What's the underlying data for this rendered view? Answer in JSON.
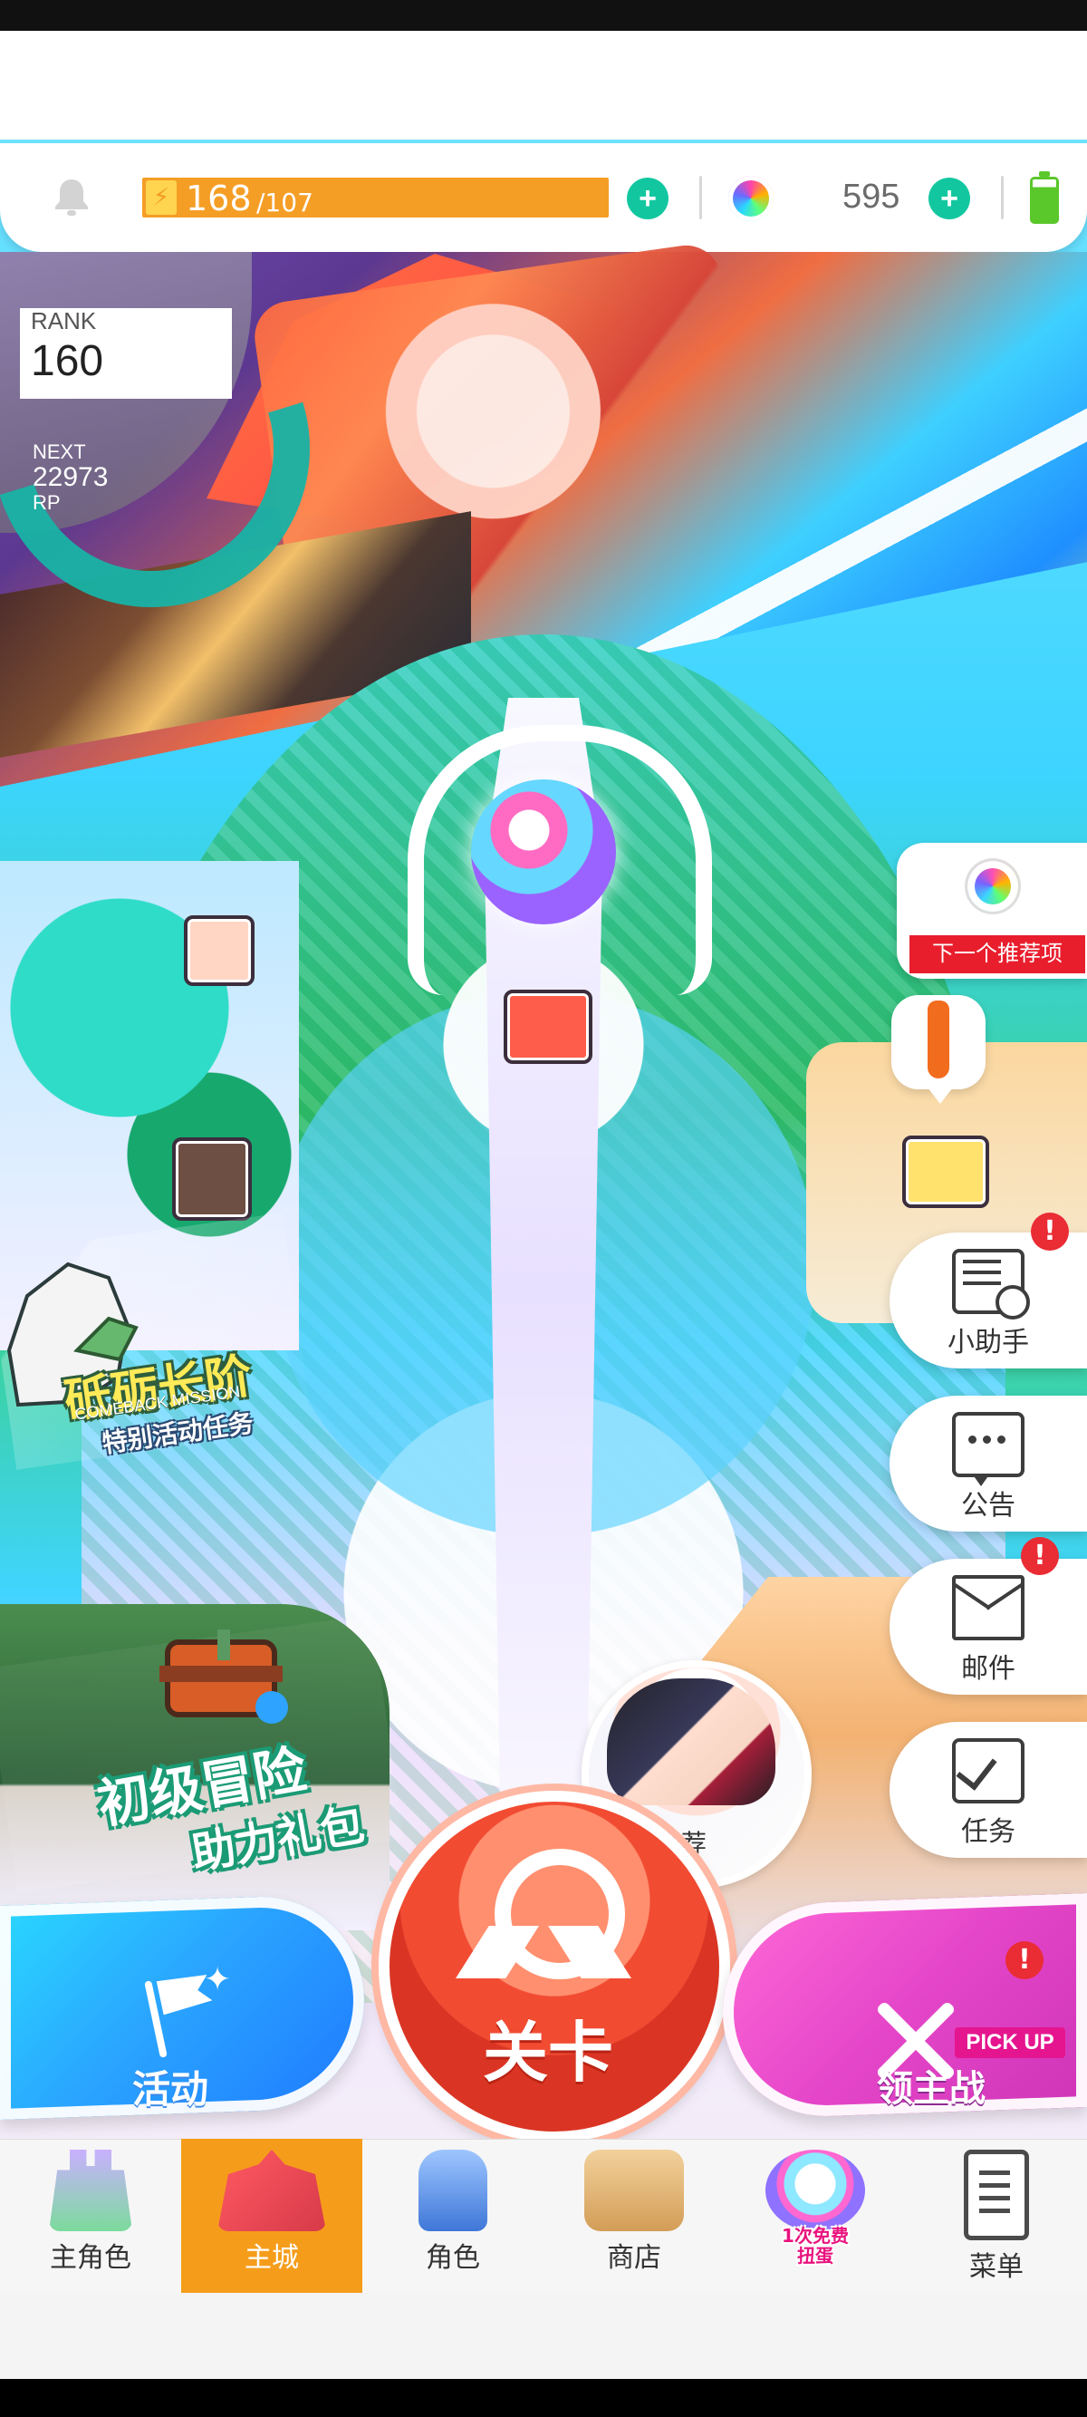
{
  "top_bar": {
    "energy_current": "168",
    "energy_max": "/107",
    "gems": "595"
  },
  "rank": {
    "label": "RANK",
    "value": "160",
    "next_label": "NEXT",
    "next_value": "22973",
    "next_unit": "RP"
  },
  "events": {
    "banner1_title": "砥砺长阶",
    "banner1_sub": "COMEBACK MISSION",
    "banner1_tag": "特别活动任务",
    "banner2_title": "初级冒险",
    "banner2_sub": "助力礼包"
  },
  "recommend": {
    "label": "下一个推荐项",
    "pill_text": "推荐"
  },
  "side_menu": {
    "assistant": "小助手",
    "notice": "公告",
    "mail": "邮件",
    "missions": "任务",
    "badge": "!"
  },
  "actions": {
    "left": "活动",
    "center": "关卡",
    "right": "领主战",
    "right_tag": "PICK UP"
  },
  "nav": {
    "protagonist": "主角色",
    "city": "主城",
    "character": "角色",
    "shop": "商店",
    "gacha_free": "1次免费\n扭蛋",
    "menu": "菜单"
  },
  "colors": {
    "accent": "#F59D1B",
    "teal": "#12C7A0",
    "red": "#E91E2D",
    "magenta": "#E546C9",
    "blue": "#2AA6FF"
  }
}
